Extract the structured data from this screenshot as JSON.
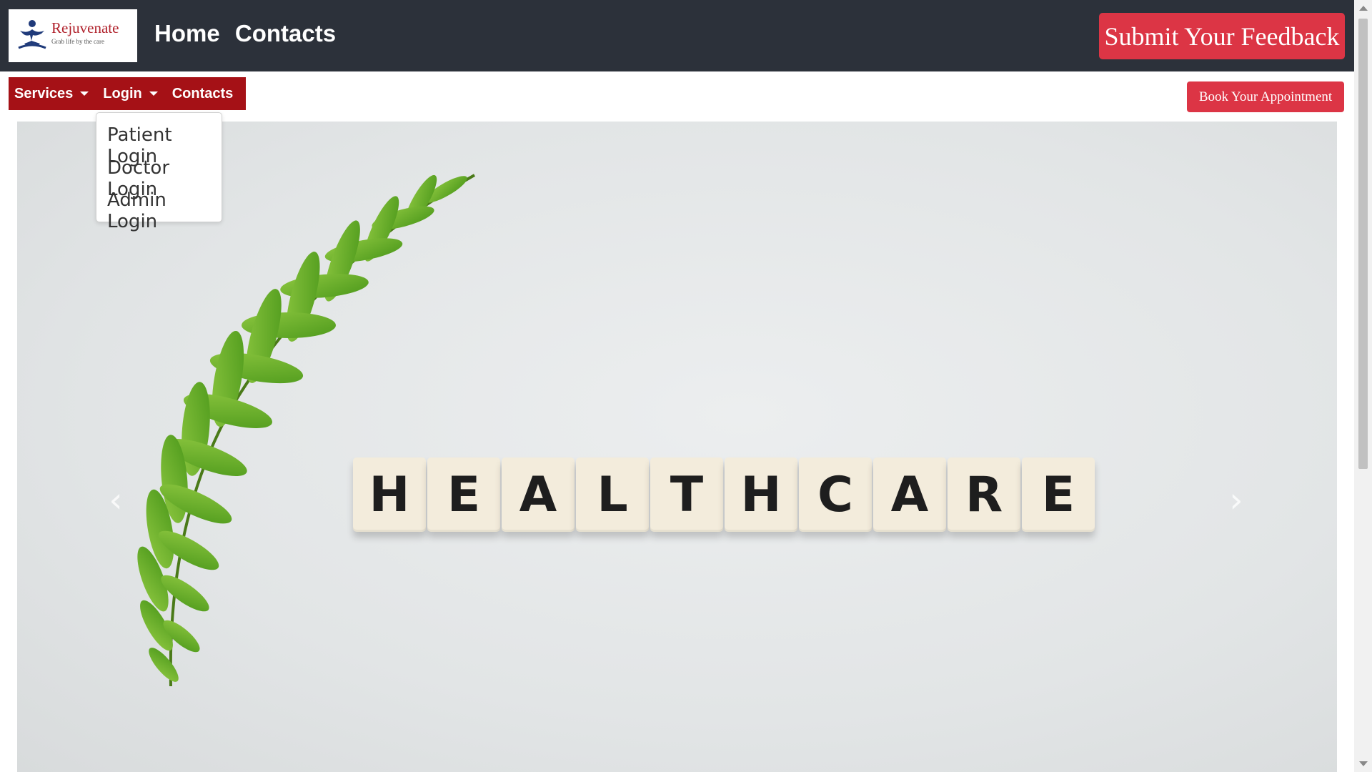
{
  "header": {
    "logo": {
      "name": "Rejuvenate",
      "tagline": "Grab life by the care"
    },
    "nav": [
      "Home",
      "Contacts"
    ],
    "feedback_button": "Submit Your Feedback"
  },
  "subnav": {
    "items": [
      {
        "label": "Services",
        "has_dropdown": true
      },
      {
        "label": "Login",
        "has_dropdown": true
      },
      {
        "label": "Contacts",
        "has_dropdown": false
      }
    ],
    "appointment_button": "Book Your Appointment"
  },
  "login_dropdown": {
    "items": [
      "Patient Login",
      "Doctor Login",
      "Admin Login"
    ]
  },
  "hero": {
    "tiles": [
      "H",
      "E",
      "A",
      "L",
      "T",
      "H",
      "C",
      "A",
      "R",
      "E"
    ],
    "prev_icon": "‹",
    "next_icon": "›"
  },
  "colors": {
    "header_bg": "#2c313a",
    "accent_red": "#dc3545",
    "nav_red": "#a51116"
  }
}
